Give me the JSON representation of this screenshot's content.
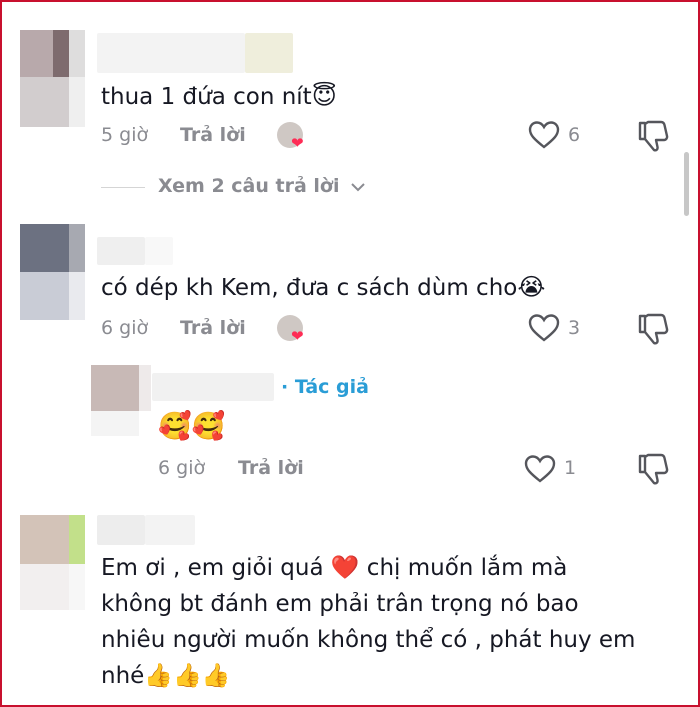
{
  "comments": [
    {
      "text": "thua 1 đứa con nít",
      "emoji": "😇",
      "time": "5 giờ",
      "reply_label": "Trả lời",
      "likes": "6"
    },
    {
      "text": "có dép kh Kem, đưa c sách dùm cho",
      "emoji": "😭",
      "time": "6 giờ",
      "reply_label": "Trả lời",
      "likes": "3"
    },
    {
      "text": "Em ơi , em giỏi quá ❤️ chị muốn lắm mà không bt đánh em phải trân trọng nó bao nhiêu người muốn không thể có , phát huy em nhé👍👍👍"
    }
  ],
  "view_replies": "Xem 2 câu trả lời",
  "reply": {
    "author_badge": "· Tác giả",
    "emojis": "🥰🥰",
    "time": "6 giờ",
    "reply_label": "Trả lời",
    "likes": "1"
  },
  "colors": {
    "border": "#c8102e",
    "author": "#2a9dd6",
    "meta": "#8a8b91",
    "text": "#161823"
  }
}
